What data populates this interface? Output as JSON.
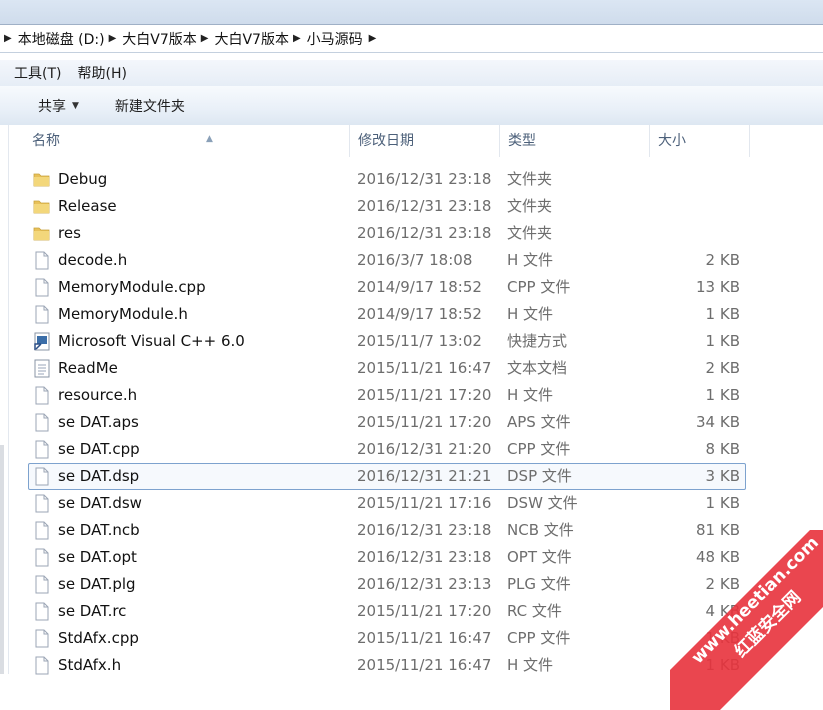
{
  "address": {
    "segments": [
      "本地磁盘 (D:)",
      "大白V7版本",
      "大白V7版本",
      "小马源码"
    ]
  },
  "menu": {
    "tools": "工具(T)",
    "help": "帮助(H)"
  },
  "toolbar": {
    "share": "共享",
    "new_folder": "新建文件夹"
  },
  "columns": {
    "name": "名称",
    "date": "修改日期",
    "type": "类型",
    "size": "大小"
  },
  "files": [
    {
      "icon": "folder-icon",
      "name": "Debug",
      "date": "2016/12/31 23:18",
      "type": "文件夹",
      "size": ""
    },
    {
      "icon": "folder-icon",
      "name": "Release",
      "date": "2016/12/31 23:18",
      "type": "文件夹",
      "size": ""
    },
    {
      "icon": "folder-icon",
      "name": "res",
      "date": "2016/12/31 23:18",
      "type": "文件夹",
      "size": ""
    },
    {
      "icon": "file-icon",
      "name": "decode.h",
      "date": "2016/3/7 18:08",
      "type": "H 文件",
      "size": "2 KB"
    },
    {
      "icon": "file-icon",
      "name": "MemoryModule.cpp",
      "date": "2014/9/17 18:52",
      "type": "CPP 文件",
      "size": "13 KB"
    },
    {
      "icon": "file-icon",
      "name": "MemoryModule.h",
      "date": "2014/9/17 18:52",
      "type": "H 文件",
      "size": "1 KB"
    },
    {
      "icon": "shortcut-icon",
      "name": "Microsoft Visual C++ 6.0",
      "date": "2015/11/7 13:02",
      "type": "快捷方式",
      "size": "1 KB"
    },
    {
      "icon": "text-document-icon",
      "name": "ReadMe",
      "date": "2015/11/21 16:47",
      "type": "文本文档",
      "size": "2 KB"
    },
    {
      "icon": "file-icon",
      "name": "resource.h",
      "date": "2015/11/21 17:20",
      "type": "H 文件",
      "size": "1 KB"
    },
    {
      "icon": "file-icon",
      "name": "se DAT.aps",
      "date": "2015/11/21 17:20",
      "type": "APS 文件",
      "size": "34 KB"
    },
    {
      "icon": "file-icon",
      "name": "se DAT.cpp",
      "date": "2016/12/31 21:20",
      "type": "CPP 文件",
      "size": "8 KB"
    },
    {
      "icon": "file-icon",
      "name": "se DAT.dsp",
      "date": "2016/12/31 21:21",
      "type": "DSP 文件",
      "size": "3 KB",
      "selected": true
    },
    {
      "icon": "file-icon",
      "name": "se DAT.dsw",
      "date": "2015/11/21 17:16",
      "type": "DSW 文件",
      "size": "1 KB"
    },
    {
      "icon": "file-icon",
      "name": "se DAT.ncb",
      "date": "2016/12/31 23:18",
      "type": "NCB 文件",
      "size": "81 KB"
    },
    {
      "icon": "file-icon",
      "name": "se DAT.opt",
      "date": "2016/12/31 23:18",
      "type": "OPT 文件",
      "size": "48 KB"
    },
    {
      "icon": "file-icon",
      "name": "se DAT.plg",
      "date": "2016/12/31 23:13",
      "type": "PLG 文件",
      "size": "2 KB"
    },
    {
      "icon": "file-icon",
      "name": "se DAT.rc",
      "date": "2015/11/21 17:20",
      "type": "RC 文件",
      "size": "4 KB"
    },
    {
      "icon": "file-icon",
      "name": "StdAfx.cpp",
      "date": "2015/11/21 16:47",
      "type": "CPP 文件",
      "size": "1 KB"
    },
    {
      "icon": "file-icon",
      "name": "StdAfx.h",
      "date": "2015/11/21 16:47",
      "type": "H 文件",
      "size": "1 KB"
    }
  ],
  "watermark": {
    "line1": "www.heetian.com",
    "line2": "红蓝安全网"
  },
  "colors": {
    "selection_border": "#7da2ce",
    "folder": "#e8c15a",
    "watermark": "#e8323c"
  }
}
